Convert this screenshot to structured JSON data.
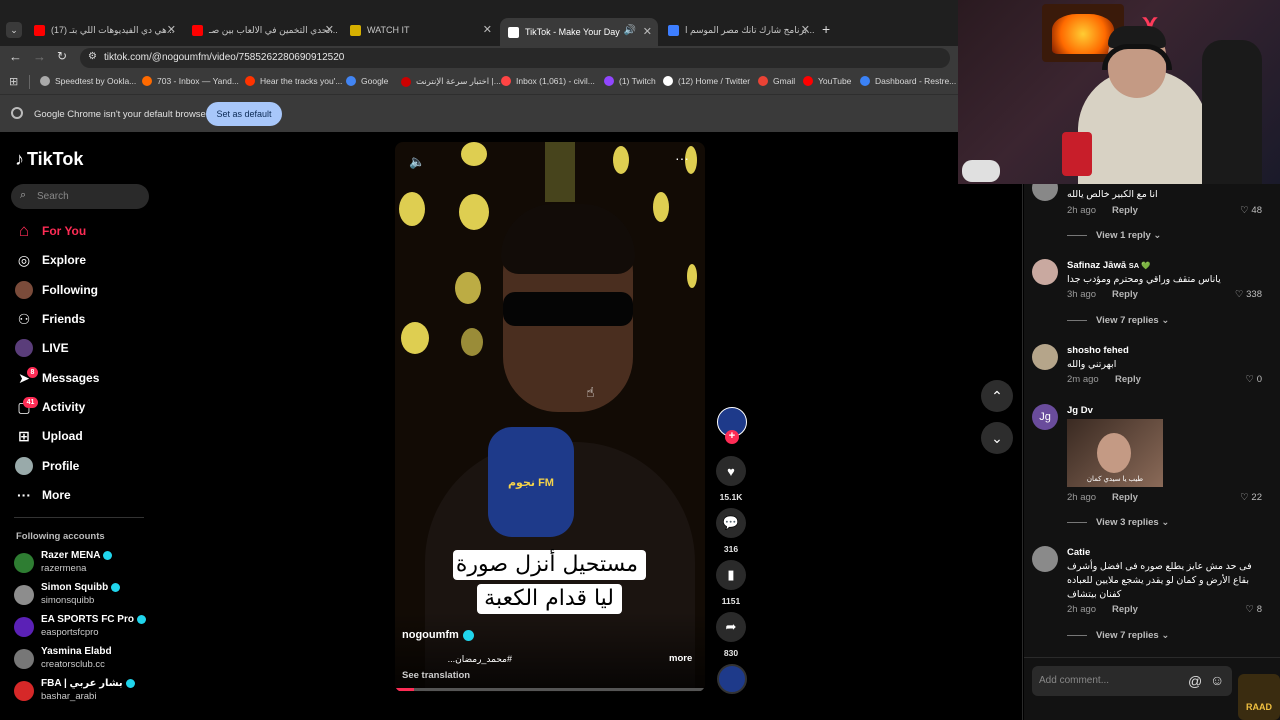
{
  "tabs": [
    {
      "label": "(17) هي دي الفيديوهات اللي بتـ...",
      "fav": "#ff0000",
      "active": false
    },
    {
      "label": "تحدي التخمين في الالعاب بين صـ...",
      "fav": "#ff0000",
      "active": false
    },
    {
      "label": "WATCH IT",
      "fav": "#d6b000",
      "active": false
    },
    {
      "label": "TikTok - Make Your Day",
      "fav": "#ffffff",
      "active": true
    },
    {
      "label": "برنامج شارك تانك مصر الموسم ا...",
      "fav": "#3d7eff",
      "active": false
    }
  ],
  "address": {
    "url": "tiktok.com/@nogoumfm/video/7585262280690912520"
  },
  "bookmarks": [
    {
      "label": "Speedtest by Ookla...",
      "color": "#aaaaaa"
    },
    {
      "label": "703 - Inbox — Yand...",
      "color": "#ff6a00"
    },
    {
      "label": "Hear the tracks you'...",
      "color": "#ff3300"
    },
    {
      "label": "Google",
      "color": "#4285f4"
    },
    {
      "label": "اختبار سرعة الإنترنت |...",
      "color": "#cc0000"
    },
    {
      "label": "Inbox (1,061) - civil...",
      "color": "#ff4444"
    },
    {
      "label": "(1) Twitch",
      "color": "#9146ff"
    },
    {
      "label": "(12) Home / Twitter",
      "color": "#ffffff"
    },
    {
      "label": "Gmail",
      "color": "#ea4335"
    },
    {
      "label": "YouTube",
      "color": "#ff0000"
    },
    {
      "label": "Dashboard - Restre...",
      "color": "#3b82f6"
    }
  ],
  "infobar": {
    "message": "Google Chrome isn't your default browser",
    "button": "Set as default"
  },
  "tiktok": {
    "logo": "TikTok",
    "search_placeholder": "Search",
    "nav": [
      {
        "label": "For You",
        "icon": "home-icon",
        "glyph": "⌂"
      },
      {
        "label": "Explore",
        "icon": "compass-icon",
        "glyph": "◎"
      },
      {
        "label": "Following",
        "icon": "following-avatar-icon",
        "glyph": "●"
      },
      {
        "label": "Friends",
        "icon": "friends-icon",
        "glyph": "👥"
      },
      {
        "label": "LIVE",
        "icon": "live-icon",
        "glyph": "◉"
      },
      {
        "label": "Messages",
        "icon": "paper-plane-icon",
        "glyph": "➤"
      },
      {
        "label": "Activity",
        "icon": "activity-icon",
        "glyph": "▢"
      },
      {
        "label": "Upload",
        "icon": "plus-square-icon",
        "glyph": "⊞"
      },
      {
        "label": "Profile",
        "icon": "profile-avatar-icon",
        "glyph": "●"
      },
      {
        "label": "More",
        "icon": "more-dots-icon",
        "glyph": "···"
      }
    ],
    "messages_badge": "8",
    "activity_badge": "41",
    "following_header": "Following accounts",
    "following": [
      {
        "name": "Razer MENA",
        "handle": "razermena",
        "color": "#2e7d32",
        "verified": true
      },
      {
        "name": "Simon Squibb",
        "handle": "simonsquibb",
        "color": "#8d8d8d",
        "verified": true
      },
      {
        "name": "EA SPORTS FC Pro",
        "handle": "easportsfcpro",
        "color": "#5b21b6",
        "verified": true
      },
      {
        "name": "Yasmina Elabd",
        "handle": "creatorsclub.cc",
        "color": "#777777",
        "verified": false
      },
      {
        "name": "FBA | بشار عربي",
        "handle": "bashar_arabi",
        "color": "#d62828",
        "verified": true
      }
    ]
  },
  "video": {
    "caption_line1": "مستحيل أنزل صورة",
    "caption_line2": "ليا قدام الكعبة",
    "author": "nogoumfm",
    "hashtags": "#محمد_رمضان...",
    "more": "more",
    "see_translation": "See translation",
    "mic_logo": "نجوم FM"
  },
  "actions": {
    "likes": "15.1K",
    "comments": "316",
    "saves": "1151",
    "shares": "830"
  },
  "comments": [
    {
      "name": "",
      "text": "انا مع الكبير خالص يالله",
      "time": "2h ago",
      "reply": "Reply",
      "likes": "48",
      "view": "View 1 reply",
      "avatar": "#888888"
    },
    {
      "name": "Safinaz Jāwā",
      "name_suffix": "SA 💚",
      "text": "ياناس متقف وراقي ومحترم ومؤدب جدا",
      "time": "3h ago",
      "reply": "Reply",
      "likes": "338",
      "view": "View 7 replies",
      "avatar": "#c9a9a0"
    },
    {
      "name": "shosho fehed",
      "text": "ابهرتني والله",
      "time": "2m ago",
      "reply": "Reply",
      "likes": "0",
      "view": "",
      "avatar": "#b5a58a"
    },
    {
      "name": "Jg Dv",
      "text": "",
      "time": "2h ago",
      "reply": "Reply",
      "likes": "22",
      "view": "View 3 replies",
      "avatar": "#6a4c9c",
      "initials": "Jg",
      "image_caption": "طيب يا سيدي كمان"
    },
    {
      "name": "Catie",
      "text": "فى حد مش عايز يطلع صوره فى افضل وأشرف بقاع الأرض و كمان لو يقدر يشجع ملايين للعباده كفنان بيتشاف",
      "time": "2h ago",
      "reply": "Reply",
      "likes": "8",
      "view": "View 7 replies",
      "avatar": "#8a8a8a"
    }
  ],
  "comment_input": {
    "placeholder": "Add comment..."
  },
  "overlay": {
    "brand": "RAAD"
  }
}
